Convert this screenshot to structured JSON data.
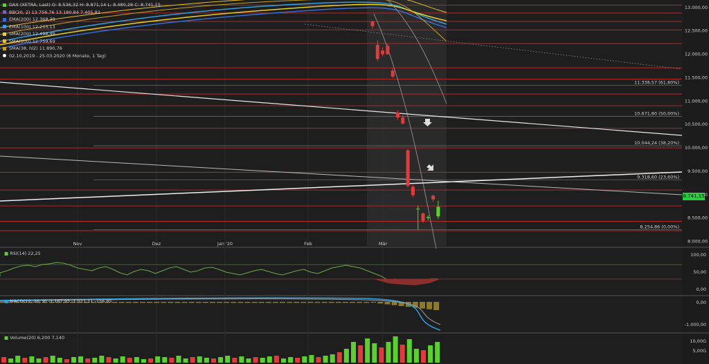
{
  "legend": {
    "title": "DAX (XETRA, Last)  O: 8.536,32  H: 8.871,14  L: 8.480,28  C: 8.741,15",
    "rows": [
      {
        "text": "BB(20, 2)  13.756,76  13.180,84  7.405,82",
        "color": "#6a6acd"
      },
      {
        "text": "EMA(200)  12.368,39",
        "color": "#2f6fd6"
      },
      {
        "text": "EMA(100)  12.233,13",
        "color": "#2fa0e0"
      },
      {
        "text": "SMA(200)  12.498,49",
        "color": "#e7d21c"
      },
      {
        "text": "SMA(100)  12.759,69",
        "color": "#e7c31c"
      },
      {
        "text": "SMA(38, hl2)  11.890,76",
        "color": "#c8a21c"
      }
    ],
    "range": "02.10.2019 - 25.03.2020  (6 Monate, 1 Tag)"
  },
  "price_axis": [
    "13.000,00",
    "12.500,00",
    "12.000,00",
    "11.500,00",
    "11.000,00",
    "10.500,00",
    "10.000,00",
    "9.500,00",
    "9.000,00",
    "8.500,00",
    "8.000,00"
  ],
  "fib_levels": [
    "11.338,57 (61,80%)",
    "10.671,80 (50,00%)",
    "10.044,24 (38,20%)",
    "9.318,60 (23,60%)",
    "8.254,86 (0,00%)"
  ],
  "last_price": "8.741,15",
  "x_labels": [
    "Nov",
    "Dez",
    "Jan '20",
    "Feb",
    "Mär"
  ],
  "rsi": {
    "label": "RSI(14)  22,25",
    "axis": [
      "100,00",
      "50,00",
      "0,00"
    ]
  },
  "macd": {
    "label": "MACD(12, 26, 9)  -1.167,95  -1.011,11  -156,85",
    "axis": [
      "0,00",
      "-1.000,00"
    ]
  },
  "volume": {
    "label": "Volume(20)  6,200  7,140",
    "axis": [
      "10,00G",
      "5,00G"
    ]
  },
  "chart_data": {
    "type": "candlestick",
    "y_unit": "DAX points",
    "ylim": [
      8000,
      13100
    ],
    "x_months": [
      "Nov",
      "Dez",
      "Jan '20",
      "Feb",
      "Mär"
    ],
    "candles_march": [
      {
        "o": 12700,
        "h": 12720,
        "l": 12550,
        "c": 12600
      },
      {
        "o": 12200,
        "h": 12300,
        "l": 11850,
        "c": 11900
      },
      {
        "o": 12080,
        "h": 12150,
        "l": 11950,
        "c": 12000
      },
      {
        "o": 12180,
        "h": 12220,
        "l": 11990,
        "c": 12000
      },
      {
        "o": 11650,
        "h": 11700,
        "l": 11500,
        "c": 11520
      },
      {
        "o": 10750,
        "h": 10800,
        "l": 10600,
        "c": 10650
      },
      {
        "o": 10650,
        "h": 10700,
        "l": 10500,
        "c": 10520
      },
      {
        "o": 9950,
        "h": 9970,
        "l": 9150,
        "c": 9190
      },
      {
        "o": 9170,
        "h": 9200,
        "l": 8950,
        "c": 8990
      },
      {
        "o": 8700,
        "h": 8760,
        "l": 8255,
        "c": 8700
      },
      {
        "o": 8600,
        "h": 8620,
        "l": 8400,
        "c": 8440
      },
      {
        "o": 8500,
        "h": 8560,
        "l": 8450,
        "c": 8520
      },
      {
        "o": 8980,
        "h": 9000,
        "l": 8850,
        "c": 8900
      },
      {
        "o": 8536,
        "h": 8871,
        "l": 8480,
        "c": 8741
      }
    ],
    "fibonacci": [
      11338.57,
      10671.8,
      10044.24,
      9318.6,
      8254.86
    ],
    "rsi_last": 22.25,
    "macd_last": [
      -1167.95,
      -1011.11,
      -156.85
    ]
  },
  "colors": {
    "up": "#5bd12d",
    "down": "#e23b3b",
    "hline": "#b22a2a"
  }
}
